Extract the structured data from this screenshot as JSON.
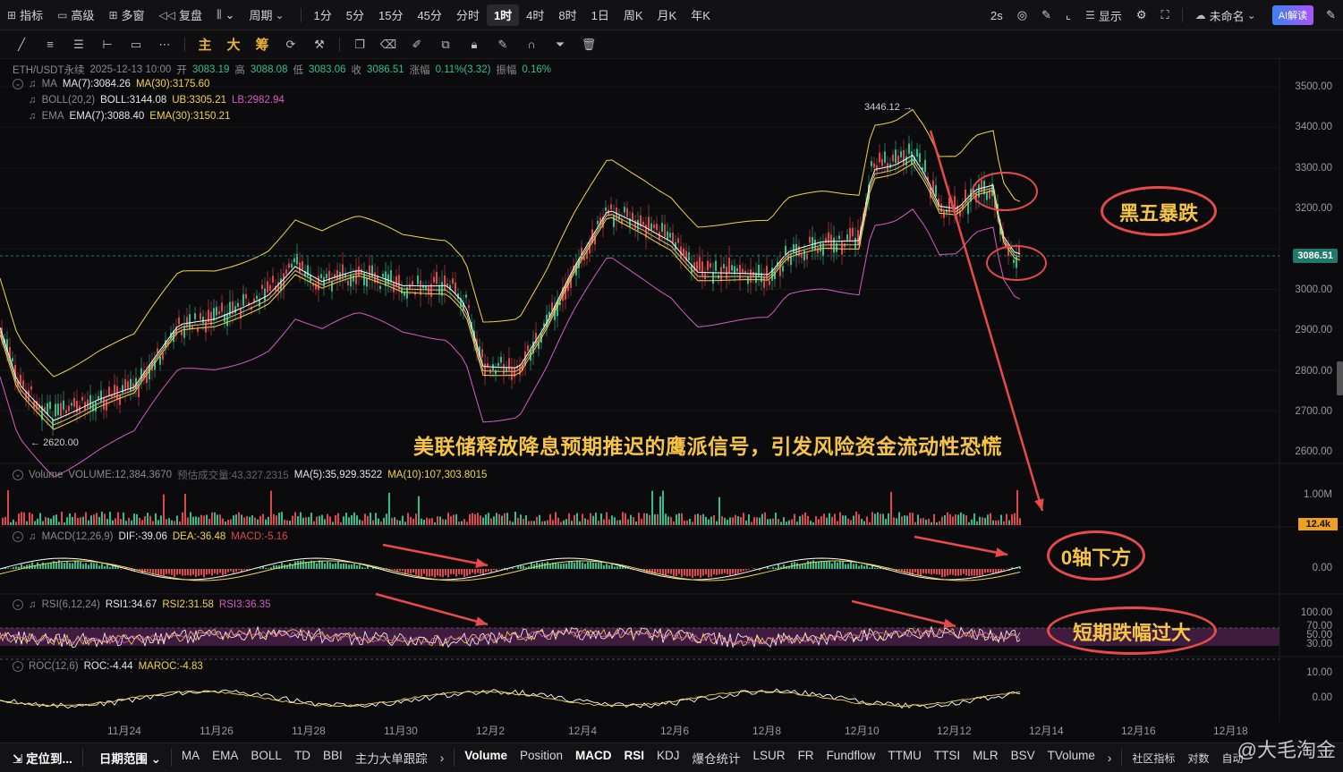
{
  "topbar": {
    "left": [
      {
        "icon": "indicator-icon",
        "glyph": "⊞",
        "label": "指标"
      },
      {
        "icon": "advanced-icon",
        "glyph": "▭",
        "label": "高级"
      },
      {
        "icon": "multiwindow-icon",
        "glyph": "⊞",
        "label": "多窗"
      },
      {
        "icon": "replay-icon",
        "glyph": "◁◁",
        "label": "复盘"
      },
      {
        "icon": "candle-type-icon",
        "glyph": "⫼",
        "label": "⌄"
      }
    ],
    "period_dropdown": "周期",
    "periods": [
      "1分",
      "5分",
      "15分",
      "45分",
      "分时",
      "1时",
      "4时",
      "8时",
      "1日",
      "周K",
      "月K",
      "年K"
    ],
    "active_period": "1时",
    "right": {
      "refresh": "2s",
      "display": "显示",
      "cloud": "未命名",
      "ai": "AI解读"
    }
  },
  "legend": {
    "symbol": "ETH/USDT永续",
    "datetime": "2025-12-13 10:00",
    "open_label": "开",
    "open": "3083.19",
    "high_label": "高",
    "high": "3088.08",
    "low_label": "低",
    "low": "3083.06",
    "close_label": "收",
    "close": "3086.51",
    "change_label": "涨幅",
    "change": "0.11%(3.32)",
    "amp_label": "振幅",
    "amp": "0.16%",
    "ma": {
      "name": "MA",
      "ma7": "MA(7):3084.26",
      "ma30": "MA(30):3175.60"
    },
    "boll": {
      "name": "BOLL(20,2)",
      "mid": "BOLL:3144.08",
      "ub": "UB:3305.21",
      "lb": "LB:2982.94"
    },
    "ema": {
      "name": "EMA",
      "ema7": "EMA(7):3088.40",
      "ema30": "EMA(30):3150.21"
    },
    "volume": {
      "name": "Volume",
      "vol": "VOLUME:12,384.3670",
      "est": "预估成交量:43,327.2315",
      "ma5": "MA(5):35,929.3522",
      "ma10": "MA(10):107,303.8015"
    },
    "macd": {
      "name": "MACD(12,26,9)",
      "dif": "DIF:-39.06",
      "dea": "DEA:-36.48",
      "macd": "MACD:-5.16"
    },
    "rsi": {
      "name": "RSI(6,12,24)",
      "rsi1": "RSI1:34.67",
      "rsi2": "RSI2:31.58",
      "rsi3": "RSI3:36.35"
    },
    "roc": {
      "name": "ROC(12,6)",
      "roc": "ROC:-4.44",
      "maroc": "MAROC:-4.83"
    }
  },
  "price_axis": [
    "3500.00",
    "3400.00",
    "3300.00",
    "3200.00",
    "3000.00",
    "2900.00",
    "2800.00",
    "2700.00",
    "2600.00"
  ],
  "last_price": "3086.51",
  "volume_axis": "1.00M",
  "last_volume": "12.4k",
  "macd_axis": "0.00",
  "rsi_axis": [
    "100.00",
    "70.00",
    "50.00",
    "30.00"
  ],
  "roc_axis": [
    "10.00",
    "0.00"
  ],
  "x_axis": [
    "11月24",
    "11月26",
    "11月28",
    "11月30",
    "12月2",
    "12月4",
    "12月6",
    "12月8",
    "12月10",
    "12月12",
    "12月14",
    "12月16",
    "12月18"
  ],
  "marks": {
    "high": "3446.12",
    "low": "2620.00"
  },
  "annotations": {
    "main": "美联储释放降息预期推迟的鹰派信号，引发风险资金流动性恐慌",
    "drop": "黑五暴跌",
    "macd": "0轴下方",
    "rsi": "短期跌幅过大"
  },
  "bottombar": {
    "locate": "定位到...",
    "date_range": "日期范围",
    "main_inds": [
      "MA",
      "EMA",
      "BOLL",
      "TD",
      "BBI",
      "主力大单跟踪"
    ],
    "sub_inds": [
      "Volume",
      "Position",
      "MACD",
      "RSI",
      "KDJ",
      "爆仓统计",
      "LSUR",
      "FR",
      "Fundflow",
      "TTMU",
      "TTSI",
      "MLR",
      "BSV",
      "TVolume"
    ],
    "active_sub": [
      "Volume",
      "MACD",
      "RSI"
    ],
    "corner": [
      "社区指标",
      "对数",
      "自动"
    ],
    "watermark": "@大毛淘金"
  },
  "colors": {
    "up": "#2fbf8f",
    "down": "#e0474c",
    "ma7": "#ffffff",
    "ma30": "#f2d44a",
    "boll": "#f2d44a",
    "lb": "#d65bc4",
    "accent": "#e74a4a"
  }
}
